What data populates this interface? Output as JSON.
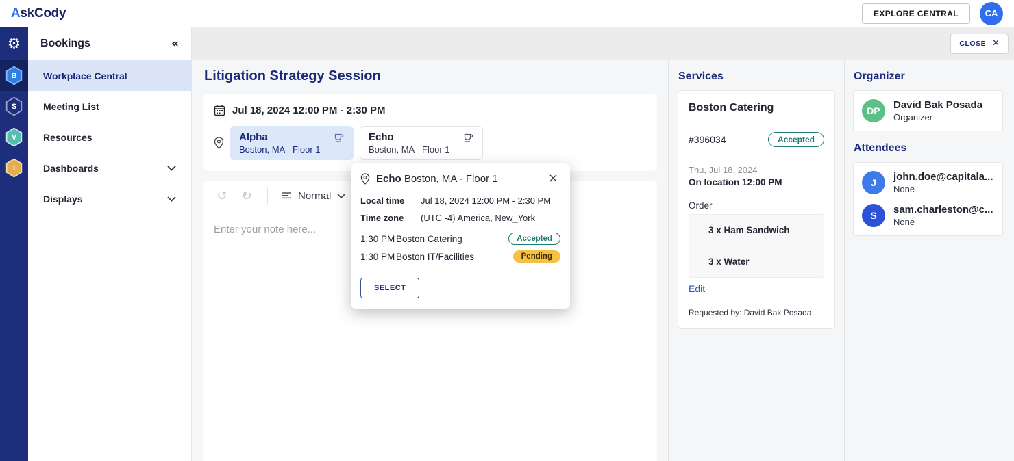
{
  "colors": {
    "brand_navy": "#1b2a7b",
    "accent_blue": "#2f6fed",
    "rail_navy": "#1d2f7c",
    "selected_room_bg": "#dce7fa",
    "accepted_teal": "#1d7a74",
    "pending_amber": "#f5c044",
    "avatar_green": "#5cbf86",
    "avatar_blue_light": "#3d7be8",
    "avatar_blue_dark": "#2c52d8"
  },
  "icons": {
    "gear": "⚙",
    "collapse": "«",
    "close_x": "✕",
    "popup_close": "×",
    "undo": "↺",
    "redo": "↻"
  },
  "header": {
    "logo_part1": "A",
    "logo_part2": "skCody",
    "explore_button": "EXPLORE CENTRAL",
    "avatar_initials": "CA"
  },
  "rail": {
    "apps": [
      {
        "letter": "B"
      },
      {
        "letter": "S"
      },
      {
        "letter": "V"
      },
      {
        "letter": "I"
      }
    ]
  },
  "sidebar": {
    "title": "Bookings",
    "items": [
      {
        "label": "Workplace Central"
      },
      {
        "label": "Meeting List"
      },
      {
        "label": "Resources"
      },
      {
        "label": "Dashboards"
      },
      {
        "label": "Displays"
      }
    ]
  },
  "topbar": {
    "close_label": "CLOSE"
  },
  "main": {
    "title": "Litigation Strategy Session",
    "datetime": "Jul 18, 2024 12:00 PM - 2:30 PM",
    "rooms": [
      {
        "name": "Alpha",
        "location": "Boston, MA - Floor 1"
      },
      {
        "name": "Echo",
        "location": "Boston, MA - Floor 1"
      }
    ],
    "editor": {
      "format_label": "Normal",
      "placeholder": "Enter your note here..."
    }
  },
  "popup": {
    "room_name": "Echo",
    "room_location": "Boston, MA - Floor 1",
    "rows": [
      {
        "label": "Local time",
        "value": "Jul 18, 2024 12:00 PM - 2:30 PM"
      },
      {
        "label": "Time zone",
        "value": "(UTC -4) America, New_York"
      }
    ],
    "services": [
      {
        "time": "1:30 PM",
        "name": "Boston Catering",
        "status": "Accepted"
      },
      {
        "time": "1:30 PM",
        "name": "Boston IT/Facilities",
        "status": "Pending"
      }
    ],
    "select_button": "SELECT"
  },
  "services_panel": {
    "title": "Services",
    "card": {
      "name": "Boston Catering",
      "order_number": "#396034",
      "status": "Accepted",
      "date": "Thu, Jul 18, 2024",
      "on_location": "On location 12:00 PM",
      "order_label": "Order",
      "order_items": [
        "3 x Ham Sandwich",
        "3 x Water"
      ],
      "edit_link": "Edit",
      "requested_by": "Requested by: David Bak Posada"
    }
  },
  "organizer_panel": {
    "title": "Organizer",
    "organizer": {
      "initials": "DP",
      "name": "David Bak Posada",
      "role": "Organizer"
    },
    "attendees_title": "Attendees",
    "attendees": [
      {
        "initial": "J",
        "email": "john.doe@capitala...",
        "response": "None"
      },
      {
        "initial": "S",
        "email": "sam.charleston@c...",
        "response": "None"
      }
    ]
  }
}
